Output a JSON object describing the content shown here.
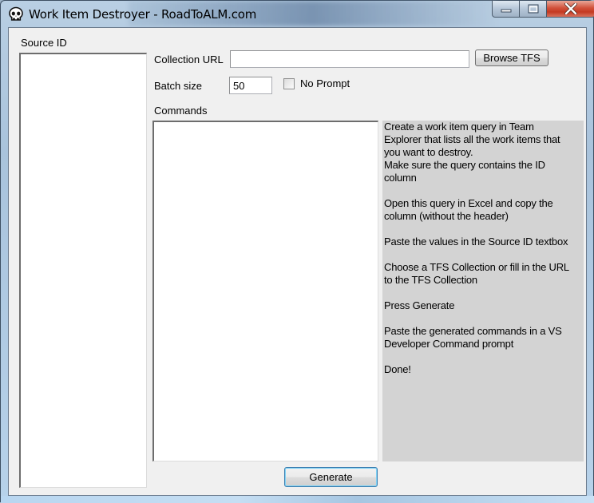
{
  "window": {
    "title": "Work Item Destroyer - RoadToALM.com",
    "icon": "skull-icon",
    "caption_buttons": [
      "minimize",
      "maximize",
      "close"
    ]
  },
  "source_id": {
    "label": "Source ID",
    "value": ""
  },
  "collection_url": {
    "label": "Collection URL",
    "value": "",
    "browse_button": "Browse TFS"
  },
  "batch_size": {
    "label": "Batch size",
    "value": "50"
  },
  "no_prompt": {
    "label": "No Prompt",
    "checked": false
  },
  "commands": {
    "label": "Commands",
    "value": ""
  },
  "help_text": "Create a work item query in Team\nExplorer that lists all the work items that\nyou want to destroy.\nMake sure the query contains the ID\ncolumn\n\nOpen this query in Excel and copy the\ncolumn (without the header)\n\nPaste the values in the Source ID textbox\n\nChoose a TFS Collection or fill in the URL\nto the TFS Collection\n\nPress Generate\n\nPaste the generated commands in a VS\nDeveloper Command prompt\n\nDone!",
  "generate_button": "Generate"
}
